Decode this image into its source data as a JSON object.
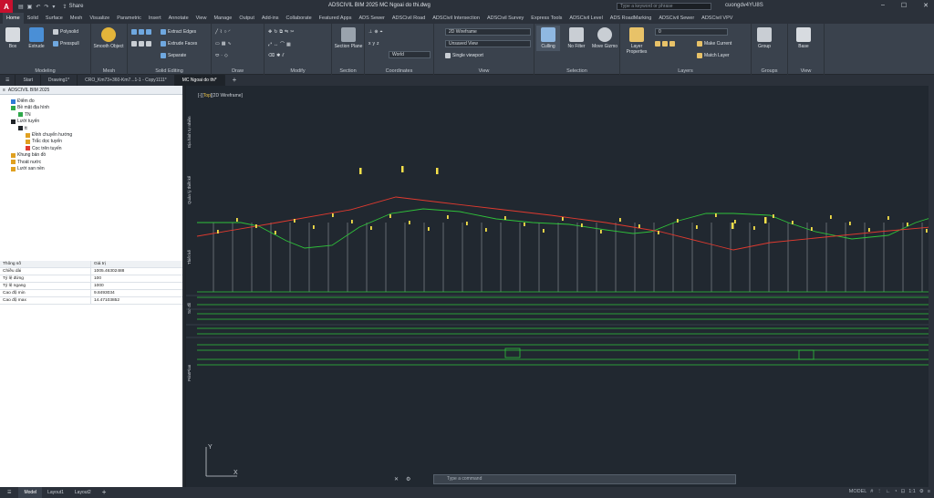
{
  "app": {
    "logo": "A",
    "title": "ADSCIVIL BIM 2025   MC Ngoai do thi.dwg",
    "share_label": "Share",
    "search_placeholder": "Type a keyword or phrase",
    "user": "cuongdv4YU8S",
    "qat_icons": [
      "open-icon",
      "save-icon",
      "undo-icon",
      "redo-icon"
    ]
  },
  "ribbon_tabs": [
    "Home",
    "Solid",
    "Surface",
    "Mesh",
    "Visualize",
    "Parametric",
    "Insert",
    "Annotate",
    "View",
    "Manage",
    "Output",
    "Add-ins",
    "Collaborate",
    "Featured Apps",
    "ADS Sewer",
    "ADSCivil Road",
    "ADSCivil Intersection",
    "ADSCivil Survey",
    "Express Tools",
    "ADSCivil Level",
    "ADS RoadMarking",
    "ADSCivil Sewer",
    "ADSCivil VPV"
  ],
  "ribbon": {
    "modeling": {
      "label": "Modeling",
      "box": "Box",
      "extrude": "Extrude",
      "polysolid": "Polysolid",
      "presspull": "Presspull"
    },
    "mesh": {
      "label": "Mesh",
      "smooth_object": "Smooth Object"
    },
    "solid_editing": {
      "label": "Solid Editing",
      "extract_edges": "Extract Edges",
      "extrude_faces": "Extrude Faces",
      "separate": "Separate"
    },
    "draw": {
      "label": "Draw"
    },
    "modify": {
      "label": "Modify"
    },
    "section": {
      "label": "Section",
      "section_plane": "Section Plane"
    },
    "coordinates": {
      "label": "Coordinates",
      "world": "World"
    },
    "view": {
      "label": "View",
      "visual_style": "2D Wireframe",
      "view_name": "Unsaved View",
      "viewport": "Single viewport"
    },
    "selection": {
      "label": "Selection",
      "culling": "Culling",
      "no_filter": "No Filter",
      "move_gizmo": "Move Gizmo"
    },
    "layers": {
      "label": "Layers",
      "layer_properties": "Layer Properties",
      "current_layer": "0",
      "make_current": "Make Current",
      "match_layer": "Match Layer"
    },
    "groups": {
      "label": "Groups",
      "group": "Group"
    },
    "view2": {
      "label": "View",
      "base": "Base"
    }
  },
  "file_tabs": {
    "start": "Start",
    "tabs": [
      "Drawing1*",
      "CRO_Km73+360-Km7...1-1 - Copy1111*",
      "MC Ngoai do thi*"
    ],
    "add": "+"
  },
  "left_panel": {
    "title": "ADSCIVIL BIM 2025",
    "tree": [
      {
        "label": "Điểm đo",
        "indent": 1
      },
      {
        "label": "Bề mặt địa hình",
        "indent": 1
      },
      {
        "label": "TN",
        "indent": 2
      },
      {
        "label": "Lưới tuyến",
        "indent": 1
      },
      {
        "label": "tt",
        "indent": 2
      },
      {
        "label": "Đỉnh chuyển hướng",
        "indent": 3
      },
      {
        "label": "Trắc dọc tuyến",
        "indent": 3
      },
      {
        "label": "Cọc trên tuyến",
        "indent": 3
      },
      {
        "label": "Khung bản đồ",
        "indent": 1
      },
      {
        "label": "Thoát nước",
        "indent": 1
      },
      {
        "label": "Lưới san nền",
        "indent": 1
      }
    ],
    "props_header": {
      "k": "Thông số",
      "v": "Giá trị"
    },
    "props": [
      {
        "k": "Chiều dài",
        "v": "1005.46302488"
      },
      {
        "k": "Tỷ lệ đứng",
        "v": "100"
      },
      {
        "k": "Tỷ lệ ngang",
        "v": "1000"
      },
      {
        "k": "Cao độ min",
        "v": "9.8493034"
      },
      {
        "k": "Cao độ max",
        "v": "14.47103852"
      }
    ]
  },
  "viewport": {
    "label_prefix": "[-][",
    "label_view": "Top",
    "label_suffix": "][2D Wireframe]",
    "side_labels": [
      "Địa hình tự nhiên",
      "Quản lý thiết kế",
      "Thiết kế",
      "Địa hình tự nhiên",
      "Sơ đồ",
      "PrintPlan"
    ],
    "ucs_x": "X",
    "ucs_y": "Y"
  },
  "command_line": {
    "placeholder": "Type a command"
  },
  "status": {
    "tabs": [
      "Model",
      "Layout1",
      "Layout2"
    ],
    "add": "+",
    "model_label": "MODEL",
    "right_icons": [
      "grid-icon",
      "snap-icon",
      "ortho-icon",
      "polar-icon",
      "osnap-icon",
      "scale-icon",
      "settings-icon",
      "menu-icon"
    ]
  }
}
